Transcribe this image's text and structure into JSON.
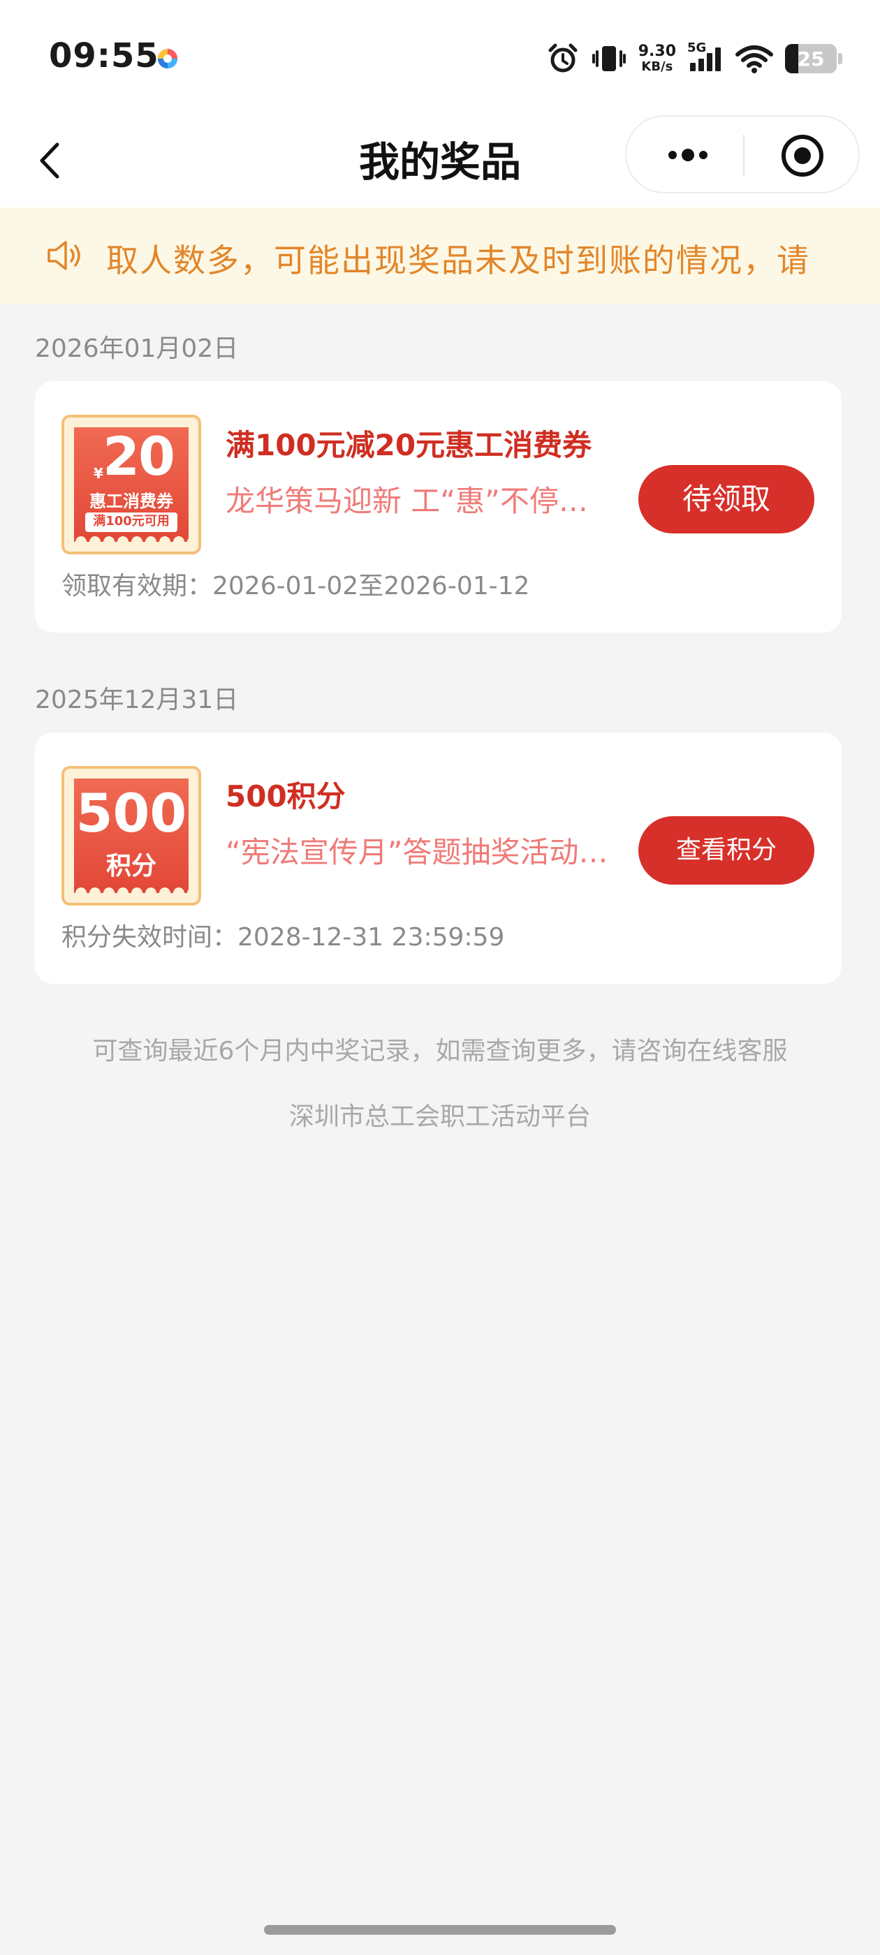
{
  "status_bar": {
    "time": "09:55",
    "net_speed_value": "9.30",
    "net_speed_unit": "KB/s",
    "network_type": "5G",
    "battery_level": "25"
  },
  "header": {
    "title": "我的奖品",
    "back_icon": "chevron-left-icon",
    "more_icon": "more-dots-icon",
    "close_icon": "target-circle-icon"
  },
  "notice": {
    "icon": "speaker-icon",
    "text": "取人数多，可能出现奖品未及时到账的情况，请"
  },
  "prizes": [
    {
      "date": "2026年01月02日",
      "ticket": {
        "currency": "¥",
        "amount": "20",
        "name": "惠工消费券",
        "condition": "满100元可用"
      },
      "title": "满100元减20元惠工消费券",
      "subtitle": "龙华策马迎新 工“惠”不停…",
      "button": "待领取",
      "validity": "领取有效期：2026-01-02至2026-01-12"
    },
    {
      "date": "2025年12月31日",
      "ticket": {
        "amount": "500",
        "name": "积分"
      },
      "title": "500积分",
      "subtitle": "“宪法宣传月”答题抽奖活动…",
      "button": "查看积分",
      "validity": "积分失效时间：2028-12-31 23:59:59"
    }
  ],
  "footer": {
    "note": "可查询最近6个月内中奖记录，如需查询更多，请咨询在线客服",
    "platform": "深圳市总工会职工活动平台"
  },
  "colors": {
    "accent": "#d7302a",
    "title_red": "#cf2e22",
    "notice_text": "#e2862a",
    "notice_bg": "#fdf8e6"
  }
}
